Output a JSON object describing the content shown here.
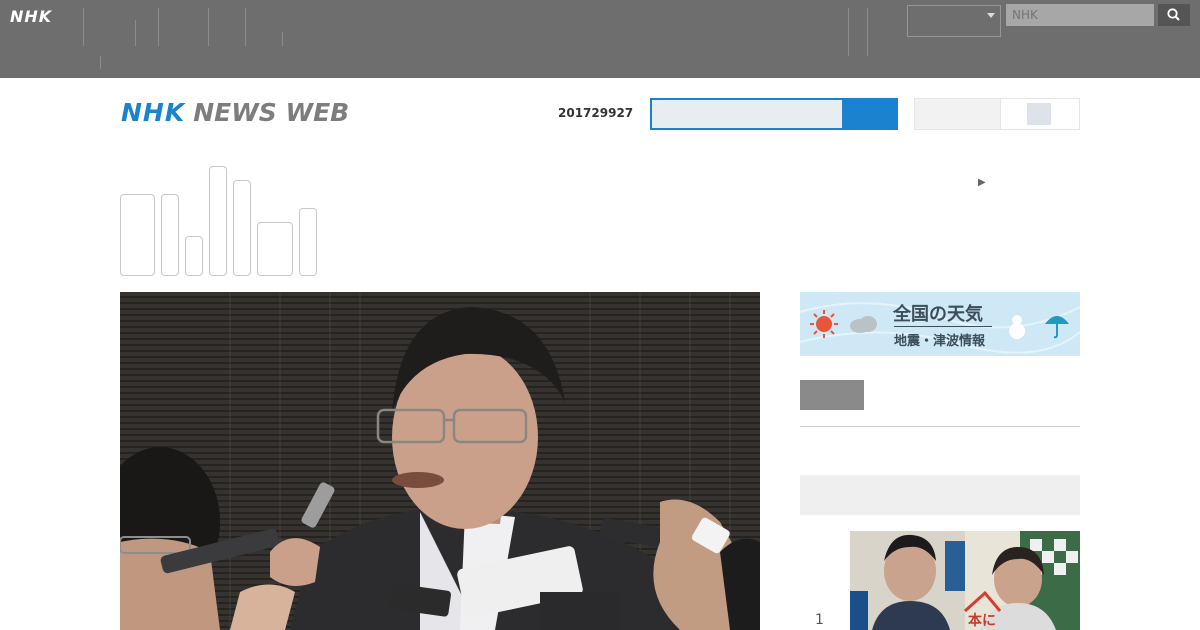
{
  "topbar": {
    "logo": "NHK",
    "nav_groups": [
      [
        "　　",
        "　　"
      ],
      [
        "　　　",
        "　　　"
      ],
      [
        "　　"
      ],
      [
        "　　　　",
        "　　　"
      ],
      [
        "　　　",
        "　　　"
      ],
      [
        "　　",
        "　　　　",
        "　　　"
      ]
    ],
    "right_group": [
      "　　",
      "　　"
    ],
    "right_group_2": [
      "　　　",
      "　　　"
    ],
    "region_select": "　　",
    "search_placeholder": "NHK"
  },
  "header": {
    "brand_nhk": "NHK",
    "brand_rest": "NEWS WEB",
    "date_code": "201729927",
    "toggle_label": "　　　　　"
  },
  "tabs": [
    [
      "　　",
      "　　",
      "　　"
    ],
    [],
    [],
    [],
    [],
    [
      "　　",
      "　　"
    ],
    []
  ],
  "promo_link": "　　　　　　　　　　",
  "sidebar": {
    "weather_title": "全国の天気",
    "weather_sub": "地震・津波情報",
    "link": "　　　　　　",
    "ranking_title": "　　　　　　　　　　",
    "rank_number": "1"
  },
  "colors": {
    "topbar": "#6e6e6e",
    "brand_blue": "#1a82cf",
    "link_blue": "#1a6fb0"
  }
}
